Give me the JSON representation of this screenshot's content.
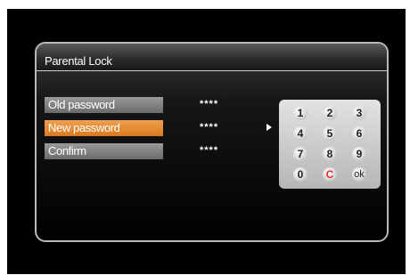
{
  "dialog": {
    "title": "Parental Lock"
  },
  "fields": [
    {
      "label": "Old password",
      "value": "****",
      "active": false
    },
    {
      "label": "New password",
      "value": "****",
      "active": true
    },
    {
      "label": "Confirm",
      "value": "****",
      "active": false
    }
  ],
  "keypad": {
    "keys": [
      "1",
      "2",
      "3",
      "4",
      "5",
      "6",
      "7",
      "8",
      "9",
      "0",
      "C",
      "ok"
    ]
  },
  "colors": {
    "active_field": "#e08a2c",
    "clear_key_text": "#e23030"
  }
}
